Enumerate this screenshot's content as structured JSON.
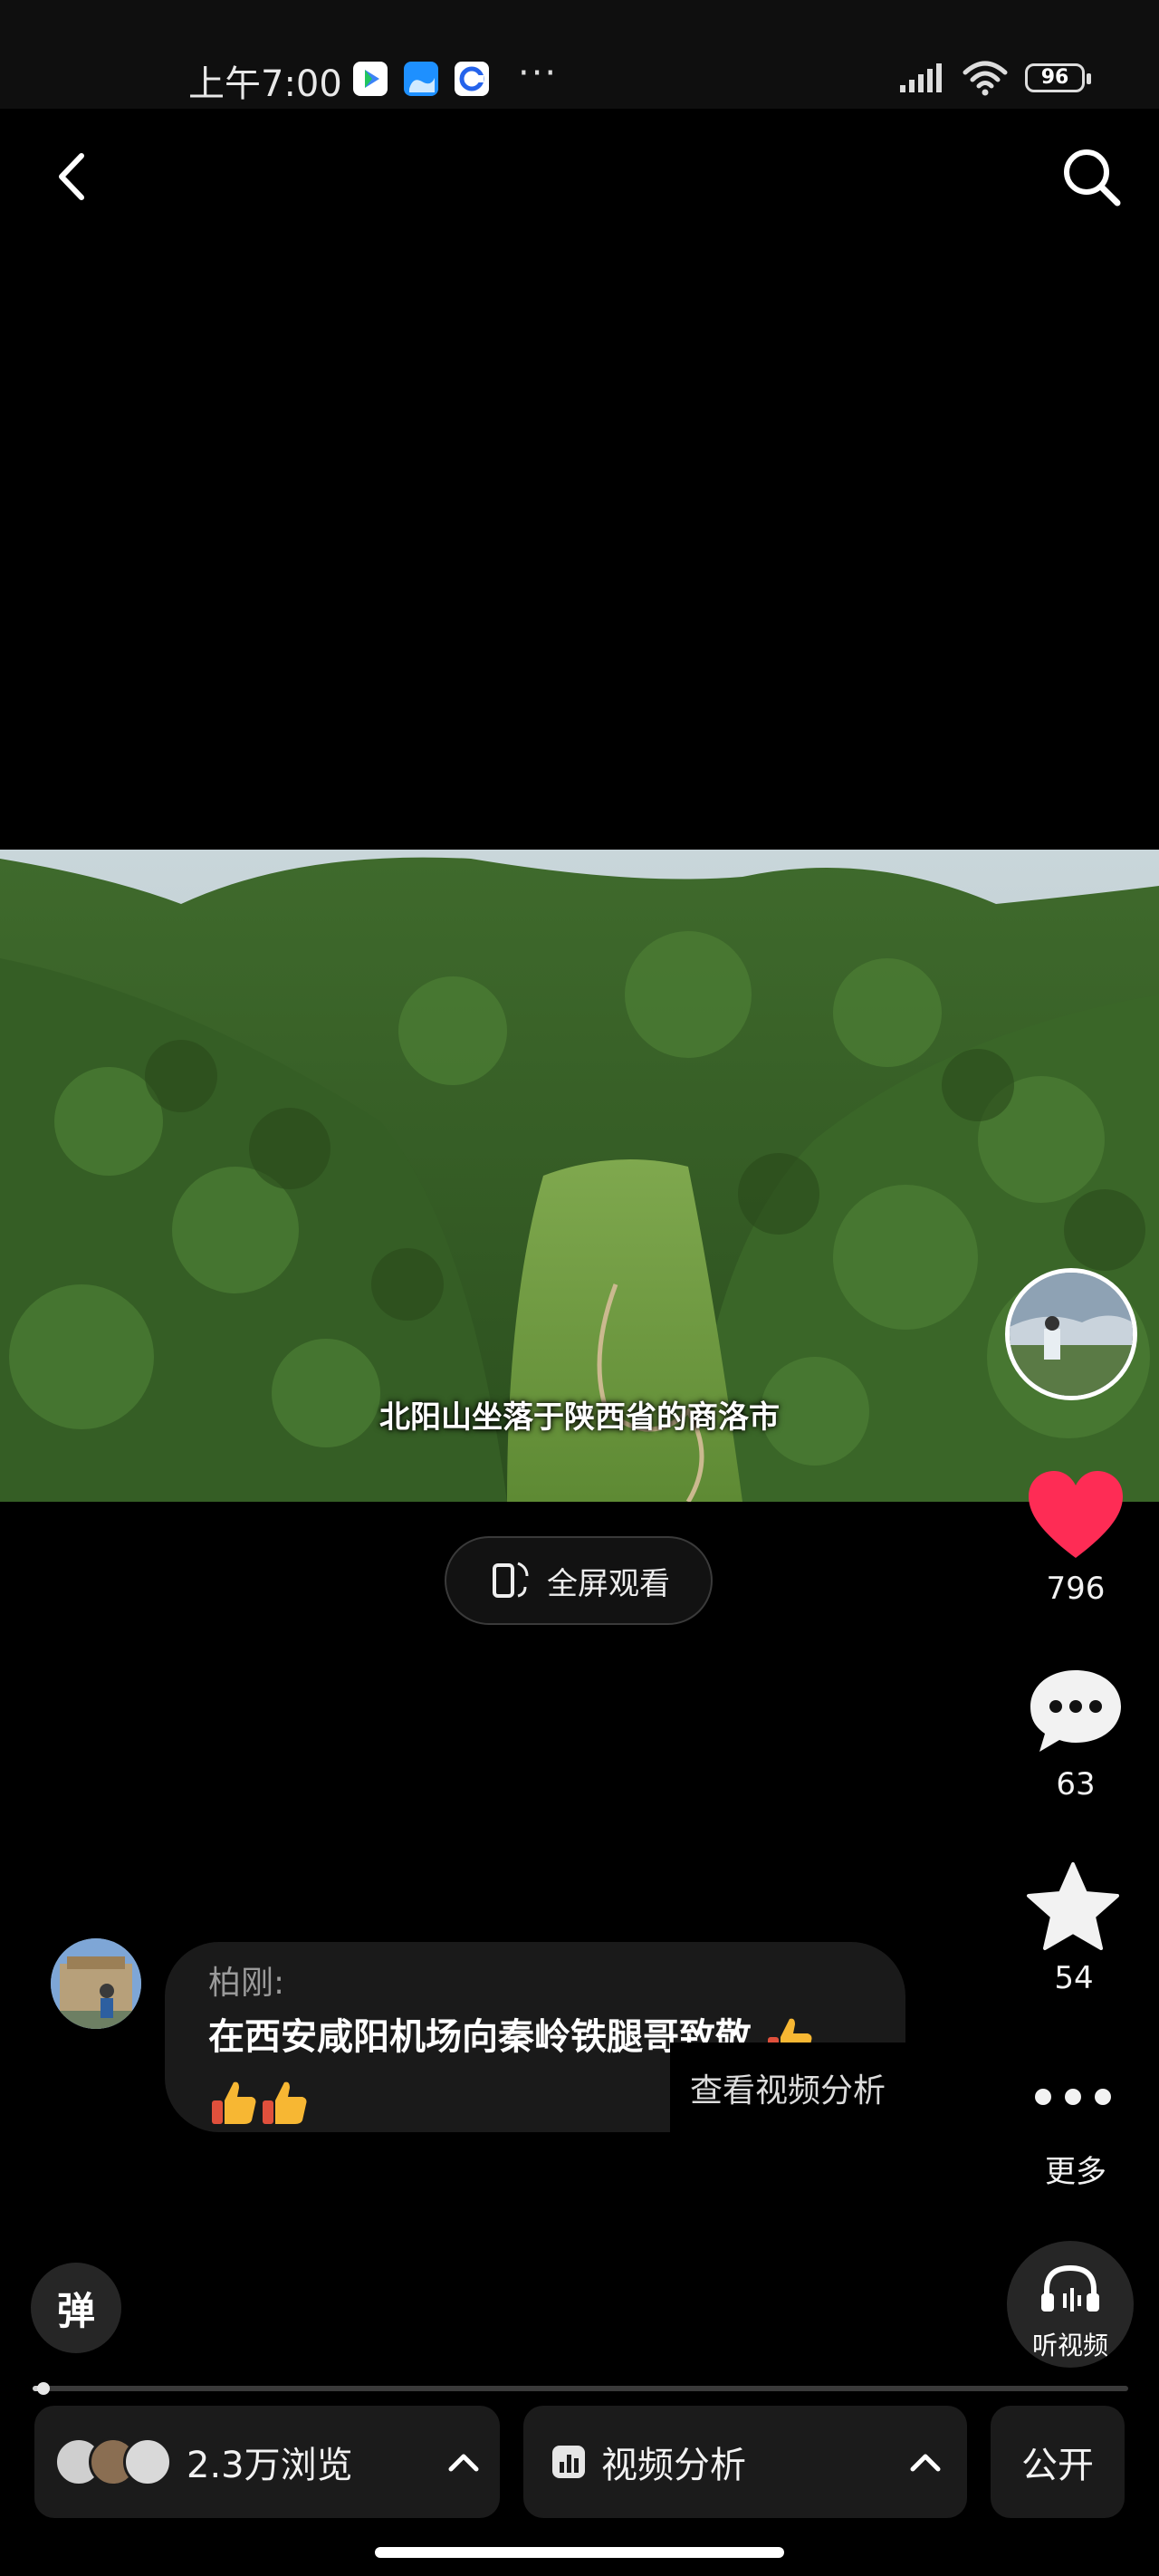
{
  "status_bar": {
    "time": "上午7:00",
    "battery": "96",
    "overflow": "···"
  },
  "video": {
    "subtitle": "北阳山坐落于陕西省的商洛市",
    "fullscreen_label": "全屏观看"
  },
  "actions": {
    "likes": "796",
    "comments": "63",
    "favorites": "54",
    "more_label": "更多",
    "like_color": "#fe2c55"
  },
  "comment": {
    "user": "柏刚:",
    "text": "在西安咸阳机场向秦岭铁腿哥致敬",
    "analysis_link": "查看视频分析"
  },
  "controls": {
    "danmaku": "弹",
    "listen_label": "听视频",
    "progress_fraction": 0.01
  },
  "bottom_bar": {
    "views": "2.3万浏览",
    "analysis": "视频分析",
    "visibility": "公开"
  },
  "icons": {
    "back": "back-arrow-icon",
    "search": "search-icon",
    "like": "heart-icon",
    "comment": "speech-bubble-icon",
    "favorite": "star-icon",
    "more": "ellipsis-icon",
    "listen": "headphones-icon",
    "fullscreen": "rotate-phone-icon",
    "analysis": "bar-chart-icon"
  }
}
